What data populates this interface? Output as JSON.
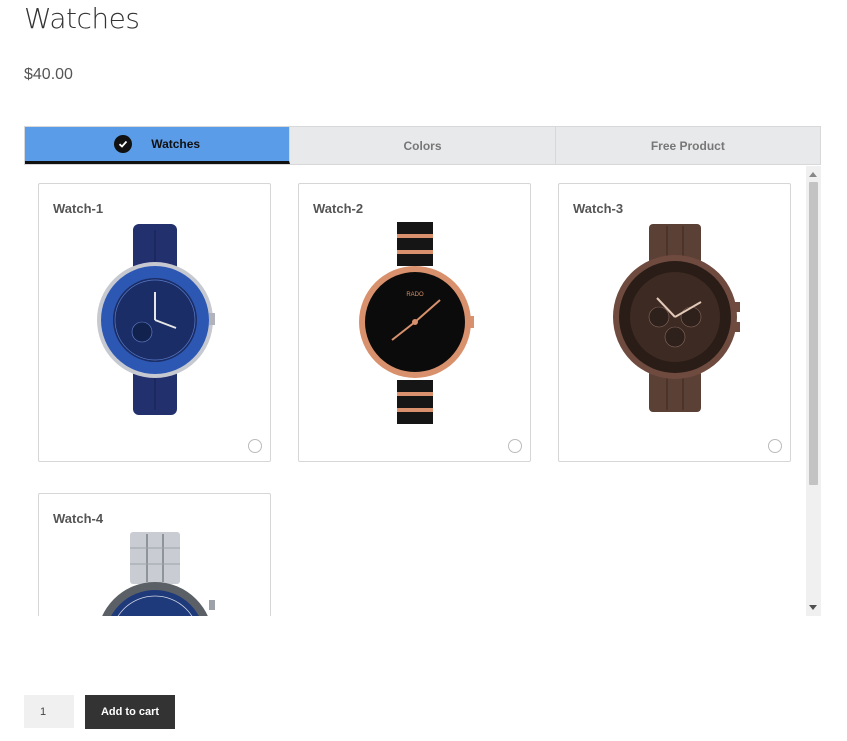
{
  "product": {
    "title": "Watches",
    "price": "$40.00"
  },
  "tabs": [
    {
      "label": "Watches",
      "active": true
    },
    {
      "label": "Colors",
      "active": false
    },
    {
      "label": "Free Product",
      "active": false
    }
  ],
  "watches": [
    {
      "name": "Watch-1",
      "selected": false
    },
    {
      "name": "Watch-2",
      "selected": false
    },
    {
      "name": "Watch-3",
      "selected": false
    },
    {
      "name": "Watch-4",
      "selected": false
    }
  ],
  "cart": {
    "quantity": "1",
    "add_label": "Add to cart"
  },
  "colors": {
    "active_tab": "#5b9ce9",
    "button": "#333333"
  }
}
